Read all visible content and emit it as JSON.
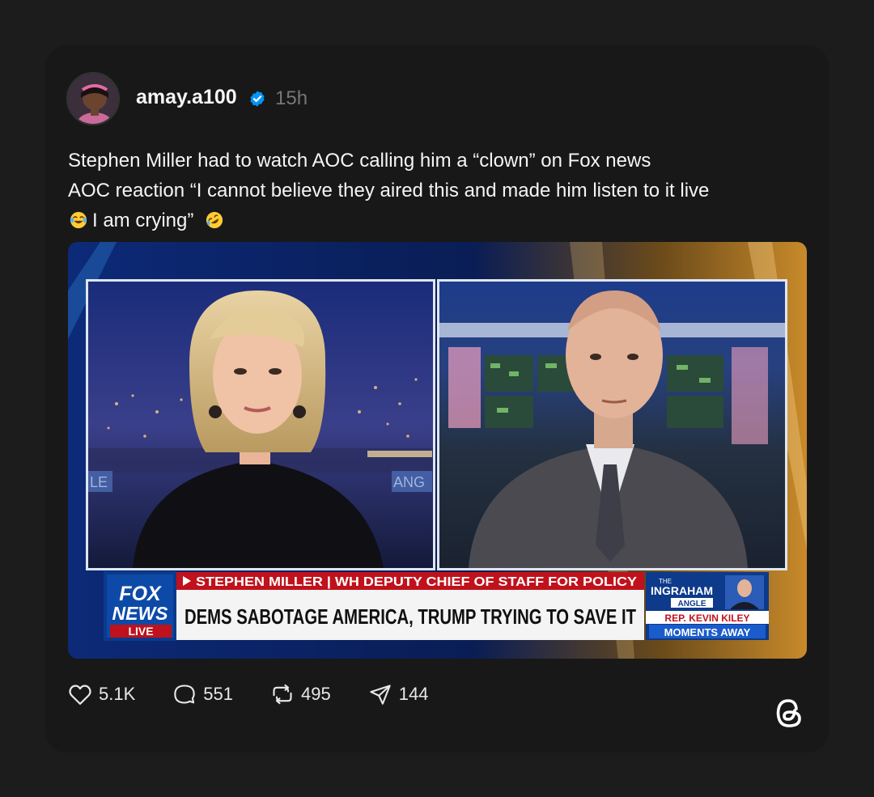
{
  "post": {
    "username": "amay.a100",
    "time": "15h",
    "text_line1": "Stephen Miller had to watch AOC calling him a “clown” on Fox news",
    "text_line2": "AOC reaction “I cannot believe they aired this and made him listen to it live",
    "text_line3a": "I am crying”",
    "emoji1": "joy-emoji",
    "emoji2": "rofl-emoji"
  },
  "video": {
    "chyron_top": "STEPHEN MILLER | WH DEPUTY CHIEF OF STAFF FOR POLICY",
    "chyron_main": "DEMS SABOTAGE AMERICA, TRUMP TRYING TO SAVE IT",
    "logo_fox": "FOX",
    "logo_news": "NEWS",
    "logo_live": "LIVE",
    "promo_the": "THE",
    "promo_show": "INGRAHAM",
    "promo_angle": "ANGLE",
    "promo_guest": "REP. KEVIN KILEY",
    "promo_soon": "MOMENTS AWAY",
    "left_wall_text": "LE",
    "right_wall_text": "ANG"
  },
  "actions": {
    "likes": "5.1K",
    "replies": "551",
    "reposts": "495",
    "shares": "144"
  },
  "icons": {
    "like": "heart-icon",
    "reply": "comment-icon",
    "repost": "repost-icon",
    "share": "send-icon",
    "brand": "threads-logo-icon",
    "verified": "verified-badge-icon"
  },
  "colors": {
    "background": "#1c1c1c",
    "card": "#181818",
    "verified": "#0095f6",
    "chyron_red": "#c0121c",
    "fox_blue": "#0a3a8c"
  }
}
